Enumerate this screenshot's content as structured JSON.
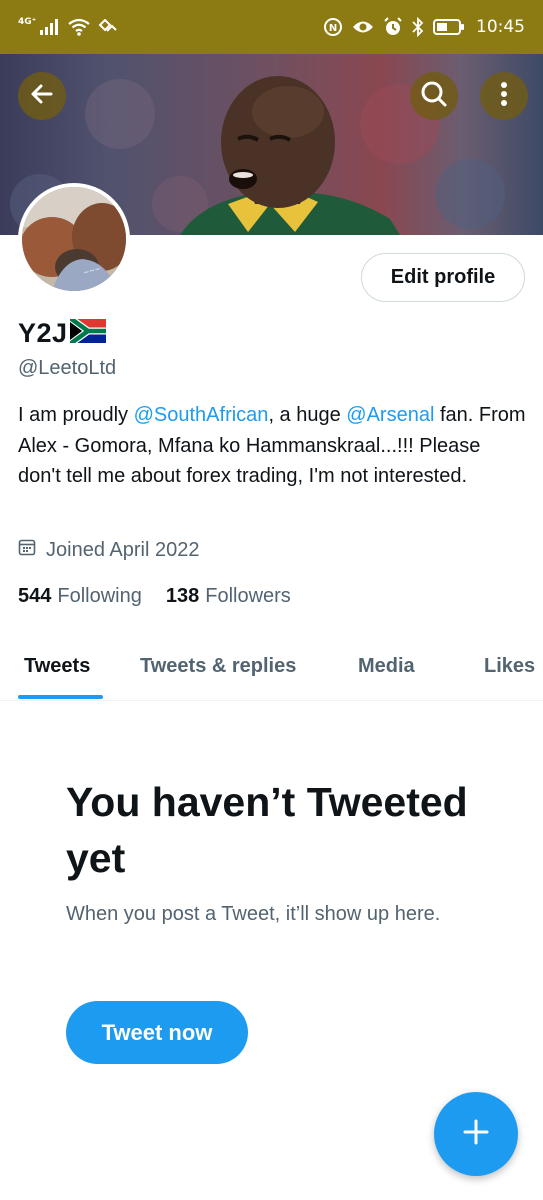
{
  "status_bar": {
    "network": "4G⁺",
    "time": "10:45"
  },
  "banner": {
    "back_icon": "arrow-left-icon",
    "search_icon": "search-icon",
    "more_icon": "more-vertical-icon"
  },
  "profile": {
    "edit_label": "Edit profile",
    "name": "Y2J",
    "flag_icon": "south-africa-flag-icon",
    "handle": "@LeetoLtd",
    "bio": {
      "part1": "I am proudly ",
      "mention1": "@SouthAfrican",
      "part2": ", a huge ",
      "mention2": "@Arsenal",
      "part3": " fan. From Alex - Gomora, Mfana ko Hammanskraal...!!! Please don't tell me about forex trading, I'm not interested."
    },
    "joined": "Joined April 2022",
    "following_count": "544",
    "following_label": "Following",
    "followers_count": "138",
    "followers_label": "Followers"
  },
  "tabs": [
    {
      "label": "Tweets",
      "active": true
    },
    {
      "label": "Tweets & replies",
      "active": false
    },
    {
      "label": "Media",
      "active": false
    },
    {
      "label": "Likes",
      "active": false
    }
  ],
  "empty_state": {
    "title": "You haven’t Tweeted yet",
    "subtitle": "When you post a Tweet, it’ll show up here.",
    "button": "Tweet now"
  },
  "fab": {
    "icon": "plus-icon"
  },
  "colors": {
    "accent": "#1d9bf0",
    "status_bar": "#8c7a13",
    "text_primary": "#0f1419",
    "text_secondary": "#536471"
  }
}
